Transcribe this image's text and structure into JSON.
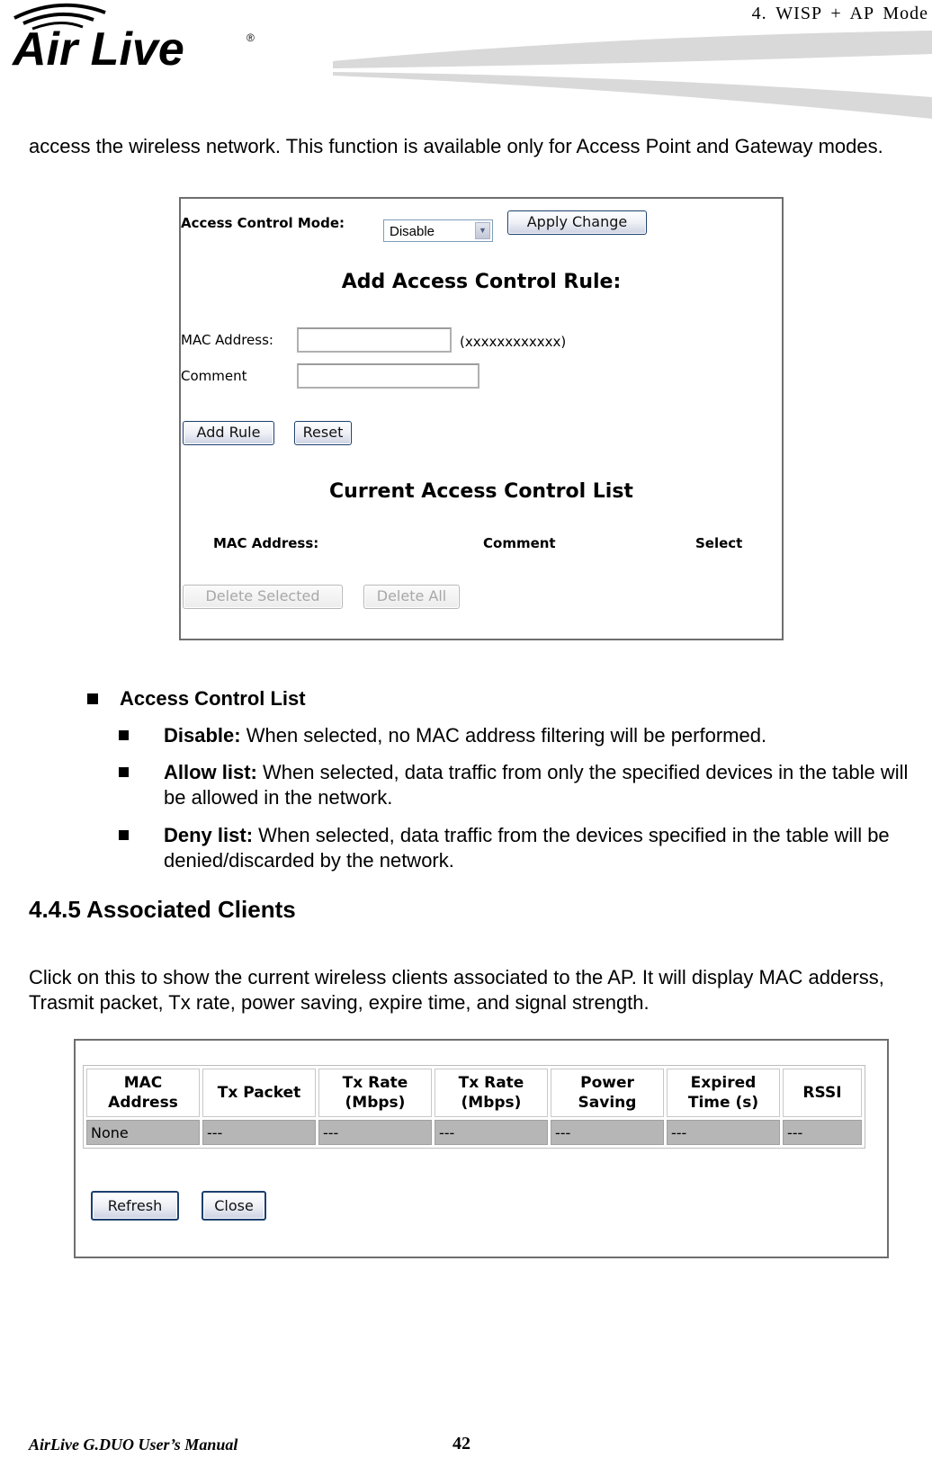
{
  "header": {
    "brand": "Air Live",
    "chapter": "4. WISP + AP Mode"
  },
  "intro": "access the wireless network.    This function is available only for Access Point and Gateway modes.",
  "acl_screen": {
    "mode_label": "Access Control Mode:",
    "mode_value": "Disable",
    "apply_button": "Apply Change",
    "add_rule_heading": "Add Access Control Rule:",
    "mac_label": "MAC Address:",
    "mac_value": "",
    "mac_hint": "(xxxxxxxxxxxx)",
    "comment_label": "Comment",
    "comment_value": "",
    "add_rule_button": "Add Rule",
    "reset_button": "Reset",
    "list_heading": "Current Access Control List",
    "columns": [
      "MAC Address:",
      "Comment",
      "Select"
    ],
    "delete_selected_button": "Delete Selected",
    "delete_all_button": "Delete All"
  },
  "bullets": {
    "main": "Access Control List",
    "items": [
      {
        "term": "Disable:",
        "text": " When selected, no MAC address filtering will be performed."
      },
      {
        "term": "Allow list:",
        "text": " When selected, data traffic from only the specified devices in the table will be allowed in the network."
      },
      {
        "term": "Deny list:",
        "text": " When selected, data traffic from the devices specified in the table will be denied/discarded by the network."
      }
    ]
  },
  "section": {
    "title": "4.4.5 Associated Clients",
    "body": "Click on this to show the current wireless clients associated to the AP.    It will display MAC adderss, Trasmit packet, Tx rate, power saving, expire time, and signal strength."
  },
  "clients_screen": {
    "headers": [
      "MAC Address",
      "Tx Packet",
      "Tx Rate (Mbps)",
      "Tx Rate (Mbps)",
      "Power Saving",
      "Expired Time (s)",
      "RSSI"
    ],
    "rows": [
      [
        "None",
        "---",
        "---",
        "---",
        "---",
        "---",
        "---"
      ]
    ],
    "refresh_button": "Refresh",
    "close_button": "Close"
  },
  "footer": {
    "manual": "AirLive G.DUO User’s Manual",
    "page": "42"
  }
}
